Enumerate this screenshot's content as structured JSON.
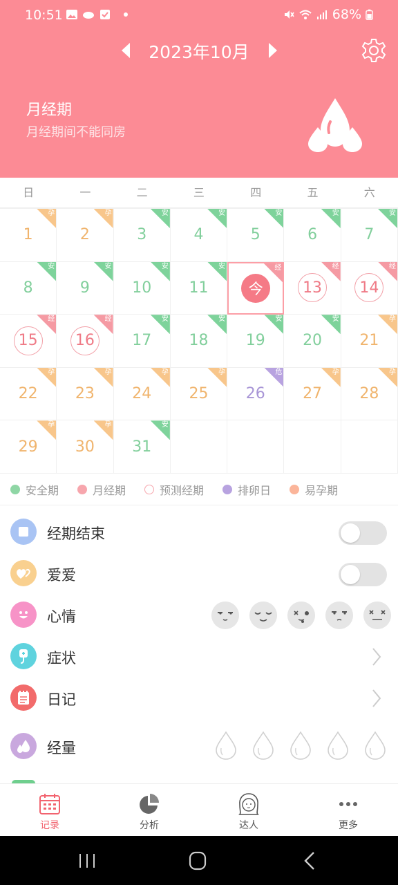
{
  "status_bar": {
    "time": "10:51",
    "battery": "68%"
  },
  "header": {
    "month": "2023年10月",
    "phase_title": "月经期",
    "phase_subtitle": "月经期间不能同房",
    "bg_color": "#fc8b95"
  },
  "weekdays": [
    "日",
    "一",
    "二",
    "三",
    "四",
    "五",
    "六"
  ],
  "calendar": {
    "today_label": "今",
    "days": [
      {
        "day": "1",
        "type": "fertile",
        "tag": "孕"
      },
      {
        "day": "2",
        "type": "fertile",
        "tag": "孕"
      },
      {
        "day": "3",
        "type": "safe",
        "tag": "安"
      },
      {
        "day": "4",
        "type": "safe",
        "tag": "安"
      },
      {
        "day": "5",
        "type": "safe",
        "tag": "安"
      },
      {
        "day": "6",
        "type": "safe",
        "tag": "安"
      },
      {
        "day": "7",
        "type": "safe",
        "tag": "安"
      },
      {
        "day": "8",
        "type": "safe",
        "tag": "安"
      },
      {
        "day": "9",
        "type": "safe",
        "tag": "安"
      },
      {
        "day": "10",
        "type": "safe",
        "tag": "安"
      },
      {
        "day": "11",
        "type": "safe",
        "tag": "安"
      },
      {
        "day": "12",
        "type": "today",
        "tag": "经"
      },
      {
        "day": "13",
        "type": "predicted",
        "tag": "经"
      },
      {
        "day": "14",
        "type": "predicted",
        "tag": "经"
      },
      {
        "day": "15",
        "type": "predicted",
        "tag": "经"
      },
      {
        "day": "16",
        "type": "predicted",
        "tag": "经"
      },
      {
        "day": "17",
        "type": "safe",
        "tag": "安"
      },
      {
        "day": "18",
        "type": "safe",
        "tag": "安"
      },
      {
        "day": "19",
        "type": "safe",
        "tag": "安"
      },
      {
        "day": "20",
        "type": "safe",
        "tag": "安"
      },
      {
        "day": "21",
        "type": "fertile",
        "tag": "孕"
      },
      {
        "day": "22",
        "type": "fertile",
        "tag": "孕"
      },
      {
        "day": "23",
        "type": "fertile",
        "tag": "孕"
      },
      {
        "day": "24",
        "type": "fertile",
        "tag": "孕"
      },
      {
        "day": "25",
        "type": "fertile",
        "tag": "孕"
      },
      {
        "day": "26",
        "type": "ovulation",
        "tag": "危"
      },
      {
        "day": "27",
        "type": "fertile",
        "tag": "孕"
      },
      {
        "day": "28",
        "type": "fertile",
        "tag": "孕"
      },
      {
        "day": "29",
        "type": "fertile",
        "tag": "孕"
      },
      {
        "day": "30",
        "type": "fertile",
        "tag": "孕"
      },
      {
        "day": "31",
        "type": "safe",
        "tag": "安"
      }
    ]
  },
  "legend": [
    {
      "label": "安全期",
      "color": "#8fd6a5",
      "style": "filled"
    },
    {
      "label": "月经期",
      "color": "#f7a6ad",
      "style": "filled"
    },
    {
      "label": "预测经期",
      "color": "#f7a6ad",
      "style": "outline"
    },
    {
      "label": "排卵日",
      "color": "#b8a3e0",
      "style": "filled"
    },
    {
      "label": "易孕期",
      "color": "#fbb59a",
      "style": "filled"
    }
  ],
  "records": {
    "period_end": "经期结束",
    "love": "爱爱",
    "mood": "心情",
    "symptoms": "症状",
    "diary": "日记",
    "flow": "经量"
  },
  "tabs": [
    {
      "label": "记录",
      "active": true
    },
    {
      "label": "分析",
      "active": false
    },
    {
      "label": "达人",
      "active": false
    },
    {
      "label": "更多",
      "active": false
    }
  ]
}
